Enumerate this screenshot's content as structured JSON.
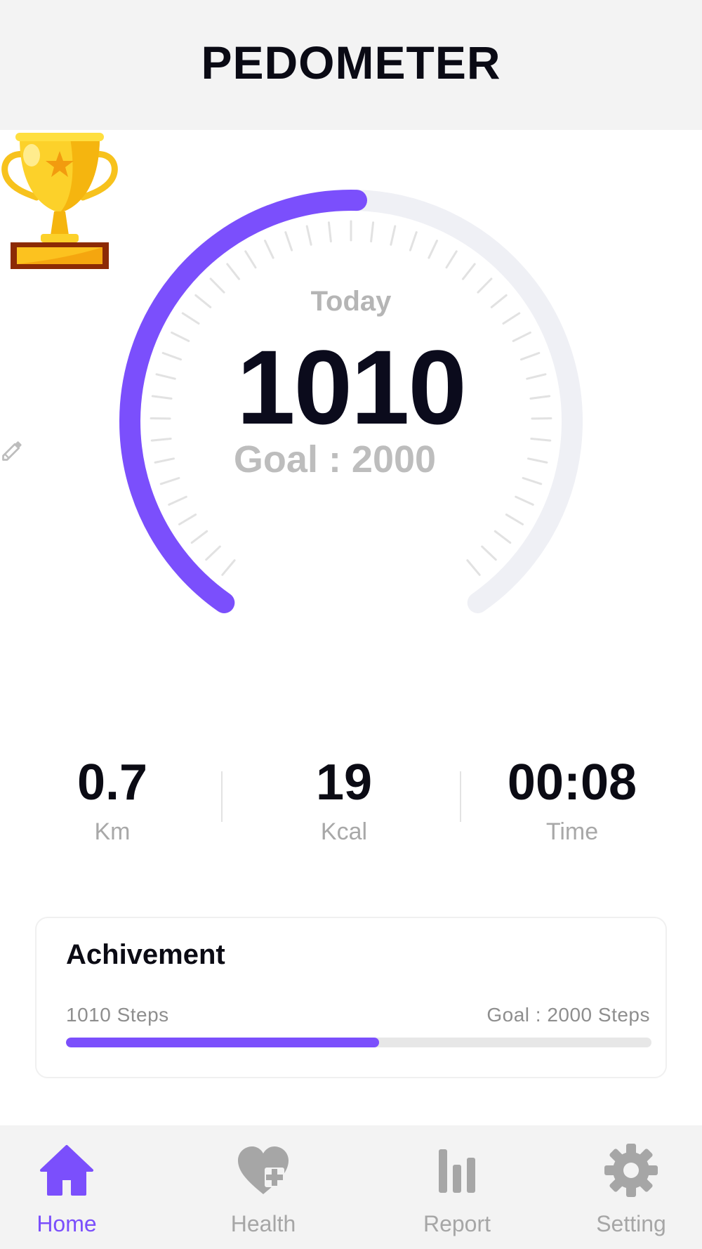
{
  "header": {
    "title": "PEDOMETER"
  },
  "gauge": {
    "label": "Today",
    "steps": "1010",
    "goal_text": "Goal : 2000",
    "progress": 0.505,
    "colors": {
      "progress": "#7b4ffc",
      "track": "#eff0f5",
      "ticks": "#e2e2e2"
    }
  },
  "stats": [
    {
      "value": "0.7",
      "unit": "Km"
    },
    {
      "value": "19",
      "unit": "Kcal"
    },
    {
      "value": "00:08",
      "unit": "Time"
    }
  ],
  "achievement": {
    "title": "Achivement",
    "current": "1010 Steps",
    "goal": "Goal : 2000 Steps",
    "progress": 0.535
  },
  "nav": {
    "items": [
      {
        "label": "Home",
        "icon": "home-icon",
        "active": true
      },
      {
        "label": "Health",
        "icon": "heart-plus-icon",
        "active": false
      },
      {
        "label": "Report",
        "icon": "bar-chart-icon",
        "active": false
      },
      {
        "label": "Setting",
        "icon": "gear-icon",
        "active": false
      }
    ],
    "active_color": "#7b4ffc",
    "inactive_color": "#a6a6a6"
  }
}
